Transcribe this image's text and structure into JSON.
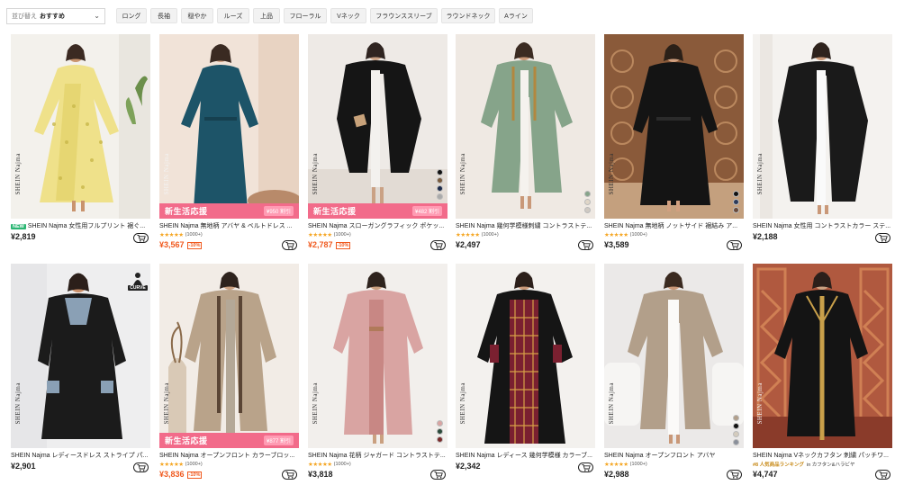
{
  "sort": {
    "label": "並び替え",
    "value": "おすすめ"
  },
  "filters": [
    "ロング",
    "長袖",
    "穏やか",
    "ルーズ",
    "上品",
    "フローラル",
    "Vネック",
    "フラウンススリーブ",
    "ラウンドネック",
    "Aライン"
  ],
  "brand_mark": "SHEIN Najma",
  "curve_badge": "CURVE",
  "banner_text": "新生活応援",
  "new_tag": "NEW",
  "colors": {
    "sale_price": "#f05a1f",
    "banner": "#f26b8a",
    "star": "#f5a623",
    "new_tag": "#2bb673"
  },
  "products": [
    {
      "title": "SHEIN Najma 女性用フルプリント 裾ぐ...",
      "price": "¥2,819",
      "is_new": true
    },
    {
      "title": "SHEIN Najma 無地柄 アバヤ & ベルトドレス ...",
      "price": "¥3,567",
      "discount": "-10%",
      "sale": true,
      "rating_count": "(1000+)",
      "banner_price": "¥950 割引"
    },
    {
      "title": "SHEIN Najma スローガングラフィック ポケッ...",
      "price": "¥2,787",
      "discount": "-10%",
      "sale": true,
      "rating_count": "(1000+)",
      "banner_price": "¥482 割引"
    },
    {
      "title": "SHEIN Najma 幾何学模様刺繍 コントラストテ...",
      "price": "¥2,497",
      "rating_count": "(1000+)"
    },
    {
      "title": "SHEIN Najma 無地柄 ノットサイド 裾結み ア...",
      "price": "¥3,589",
      "rating_count": "(1000+)"
    },
    {
      "title": "SHEIN Najma 女性用 コントラストカラー ステ...",
      "price": "¥2,188"
    },
    {
      "title": "SHEIN Najma レディースドレス ストライプ パ...",
      "price": "¥2,901"
    },
    {
      "title": "SHEIN Najma オープンフロント カラーブロッ...",
      "price": "¥3,836",
      "discount": "-10%",
      "sale": true,
      "rating_count": "(1000+)",
      "banner_price": "¥877 割引"
    },
    {
      "title": "SHEIN Najma 花柄 ジャガード コントラストテ...",
      "price": "¥3,818",
      "rating_count": "(1000+)"
    },
    {
      "title": "SHEIN Najma レディース 幾何学模様 カラーブ...",
      "price": "¥2,342"
    },
    {
      "title": "SHEIN Najma オープンフロント アバヤ",
      "price": "¥2,988",
      "rating_count": "(1000+)"
    },
    {
      "title": "SHEIN Najma Vネックカフタン 刺繍 パッチワ...",
      "price": "¥4,747",
      "rank": "#8 人気商品ランキング",
      "rank_cat": "in カフタン&ハラビヤ"
    }
  ]
}
